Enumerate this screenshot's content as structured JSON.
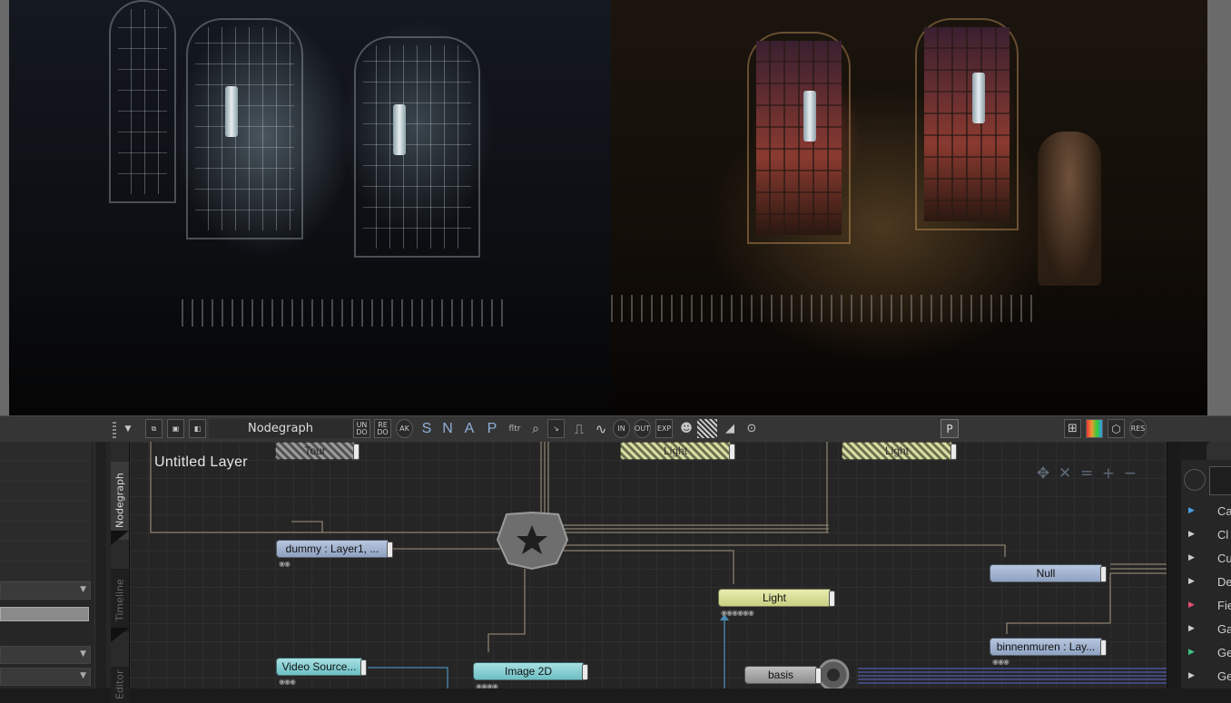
{
  "toolbar": {
    "title": "Nodegraph",
    "undo_icon": "UN DO",
    "redo_icon": "RE DO",
    "letters": [
      "S",
      "N",
      "A",
      "P"
    ],
    "filter_icon": "fltr",
    "in_icon": "IN",
    "out_icon": "OUT",
    "exp_icon": "EXP",
    "p_button": "P",
    "res_icon": "RES"
  },
  "sidetabs": {
    "nodegraph": "Nodegraph",
    "timeline": "Timeline",
    "editor": "Editor"
  },
  "graph": {
    "layer_title": "Untitled  Layer",
    "nodes": {
      "top_gray": "Tour",
      "top_light1": "Light",
      "top_light2": "Light",
      "dummy": "dummy  : Layer1,  ...",
      "null": "Null",
      "light": "Light",
      "binnenmuren": "binnenmuren  : Lay...",
      "video_source": "Video Source...",
      "image2d": "Image  2D",
      "basis": "basis"
    }
  },
  "right_panel": {
    "items": [
      {
        "label": "Ca",
        "arrow_color": "#4aa0e0"
      },
      {
        "label": "Cl",
        "arrow_color": "#cccccc"
      },
      {
        "label": "Cu",
        "arrow_color": "#cccccc"
      },
      {
        "label": "De",
        "arrow_color": "#cccccc"
      },
      {
        "label": "Fie",
        "arrow_color": "#e05070"
      },
      {
        "label": "Ga",
        "arrow_color": "#cccccc"
      },
      {
        "label": "Ge",
        "arrow_color": "#40c080"
      },
      {
        "label": "Ge",
        "arrow_color": "#cccccc"
      }
    ]
  }
}
